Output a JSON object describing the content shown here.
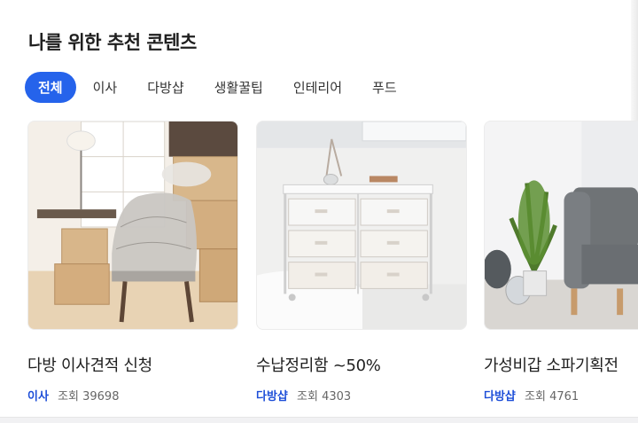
{
  "section": {
    "title": "나를 위한 추천 콘텐츠"
  },
  "tabs": [
    {
      "label": "전체",
      "active": true
    },
    {
      "label": "이사",
      "active": false
    },
    {
      "label": "다방샵",
      "active": false
    },
    {
      "label": "생활꿀팁",
      "active": false
    },
    {
      "label": "인테리어",
      "active": false
    },
    {
      "label": "푸드",
      "active": false
    }
  ],
  "cards": [
    {
      "title": "다방 이사견적 신청",
      "category": "이사",
      "views_label": "조회 39698"
    },
    {
      "title": "수납정리함 ~50%",
      "category": "다방샵",
      "views_label": "조회 4303"
    },
    {
      "title": "가성비갑 소파기획전",
      "category": "다방샵",
      "views_label": "조회 4761"
    }
  ],
  "colors": {
    "accent": "#2563eb",
    "category": "#1d4ed8"
  }
}
